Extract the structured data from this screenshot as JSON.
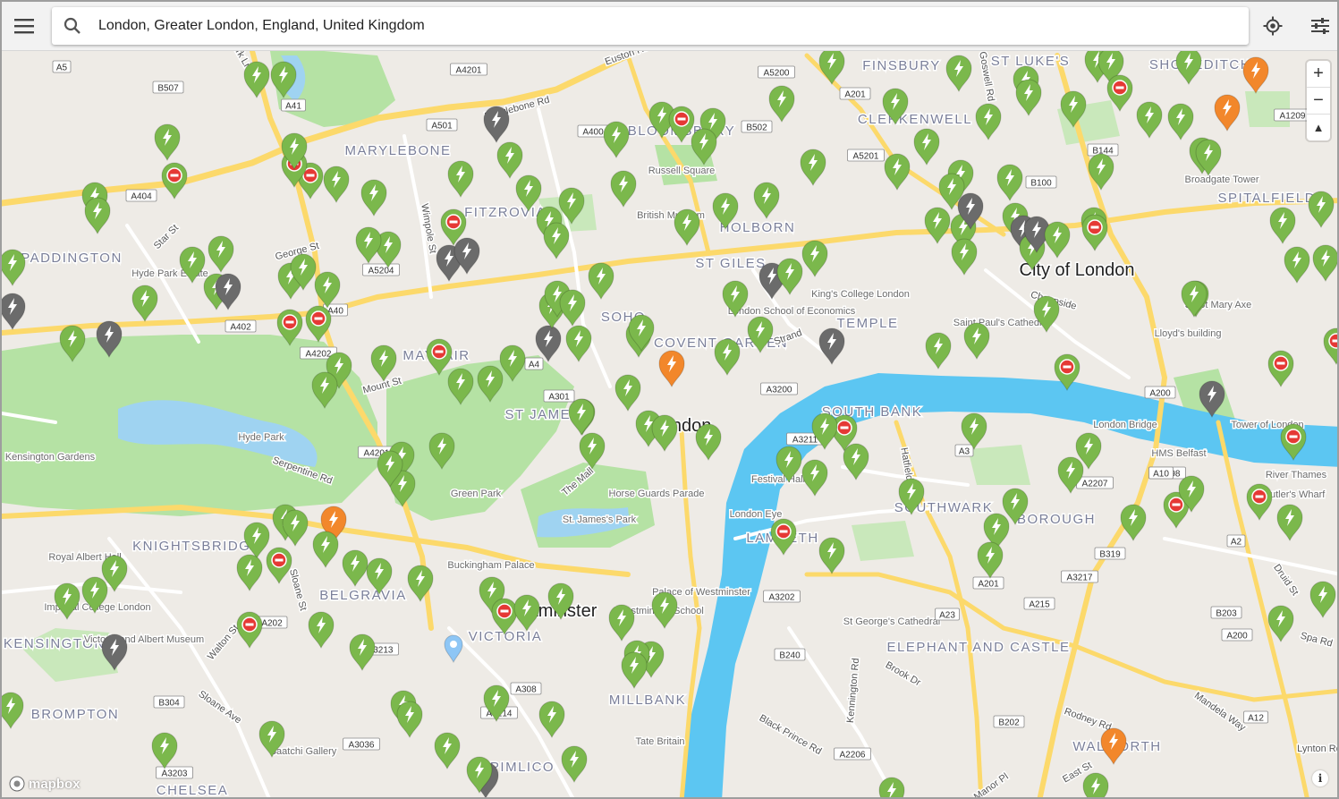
{
  "search": {
    "value": "London, Greater London, England, United Kingdom"
  },
  "icons": {
    "menu": "menu-icon",
    "search": "search-icon",
    "locate": "crosshair-icon",
    "filter": "sliders-icon",
    "zoom_in": "plus-icon",
    "zoom_out": "minus-icon",
    "compass": "compass-icon",
    "info": "info-icon"
  },
  "zoom": {
    "in_label": "+",
    "out_label": "−",
    "compass_label": "▲"
  },
  "attribution": {
    "logo_text": "mapbox",
    "info_label": "i"
  },
  "colors": {
    "water": "#9fd3f1",
    "river": "#5cc6f2",
    "park": "#b5e2a4",
    "land": "#eeebe6",
    "road": "#ffffff",
    "main_road": "#fcd96b",
    "pin_green": "#7bb84c",
    "pin_grey": "#6b6b6b",
    "pin_orange": "#f2872b",
    "pin_blue": "#8ec6f5"
  },
  "map": {
    "districts": [
      {
        "name": "MARYLEBONE"
      },
      {
        "name": "FITZROVIA"
      },
      {
        "name": "FINSBURY"
      },
      {
        "name": "ST LUKE'S"
      },
      {
        "name": "SHOREDITCH"
      },
      {
        "name": "CLERKENWELL"
      },
      {
        "name": "BLOOMSBURY"
      },
      {
        "name": "HOLBORN"
      },
      {
        "name": "ST GILES"
      },
      {
        "name": "SOHO"
      },
      {
        "name": "COVENT GARDEN"
      },
      {
        "name": "TEMPLE"
      },
      {
        "name": "MAYFAIR"
      },
      {
        "name": "ST JAMES'S"
      },
      {
        "name": "SOUTH BANK"
      },
      {
        "name": "SOUTHWARK"
      },
      {
        "name": "BOROUGH"
      },
      {
        "name": "LAMBETH"
      },
      {
        "name": "KNIGHTSBRIDGE"
      },
      {
        "name": "BELGRAVIA"
      },
      {
        "name": "VICTORIA"
      },
      {
        "name": "MILLBANK"
      },
      {
        "name": "PIMLICO"
      },
      {
        "name": "BROMPTON"
      },
      {
        "name": "PADDINGTON"
      },
      {
        "name": "SPITALFIELDS"
      },
      {
        "name": "ELEPHANT AND CASTLE"
      },
      {
        "name": "WALWORTH"
      },
      {
        "name": "CHELSEA"
      },
      {
        "name": "SOUTH KENSINGTON"
      }
    ],
    "city_labels": [
      {
        "name": "City of London"
      },
      {
        "name": "Westminster"
      },
      {
        "name": "London"
      }
    ],
    "places": [
      {
        "name": "Russell Square"
      },
      {
        "name": "British Museum"
      },
      {
        "name": "King's College London"
      },
      {
        "name": "London School of Economics"
      },
      {
        "name": "Saint Paul's Cathedral"
      },
      {
        "name": "Lloyd's building"
      },
      {
        "name": "Broadgate Tower"
      },
      {
        "name": "30 St Mary Axe"
      },
      {
        "name": "Tower of London"
      },
      {
        "name": "London Bridge"
      },
      {
        "name": "HMS Belfast"
      },
      {
        "name": "River Thames"
      },
      {
        "name": "Butler's Wharf"
      },
      {
        "name": "Hyde Park"
      },
      {
        "name": "Kensington Gardens"
      },
      {
        "name": "Green Park"
      },
      {
        "name": "St. James's Park"
      },
      {
        "name": "Horse Guards Parade"
      },
      {
        "name": "Buckingham Palace"
      },
      {
        "name": "Palace of Westminster"
      },
      {
        "name": "London Eye"
      },
      {
        "name": "Festival Hall"
      },
      {
        "name": "St George's Cathedral"
      },
      {
        "name": "Tate Britain"
      },
      {
        "name": "Royal Albert Hall"
      },
      {
        "name": "Victoria and Albert Museum"
      },
      {
        "name": "Imperial College London"
      },
      {
        "name": "Hyde Park Estate"
      },
      {
        "name": "Saatchi Gallery"
      },
      {
        "name": "Westminster School"
      }
    ],
    "streets": [
      {
        "name": "Serpentine Rd"
      },
      {
        "name": "The Mall"
      },
      {
        "name": "Strand"
      },
      {
        "name": "Mount St"
      },
      {
        "name": "George St"
      },
      {
        "name": "Star St"
      },
      {
        "name": "Wimpole St"
      },
      {
        "name": "Sloane St"
      },
      {
        "name": "Walton St"
      },
      {
        "name": "Sloane Ave"
      },
      {
        "name": "Black Prince Rd"
      },
      {
        "name": "Kennington Rd"
      },
      {
        "name": "Brook Dr"
      },
      {
        "name": "Rodney Rd"
      },
      {
        "name": "Mandela Way"
      },
      {
        "name": "Druid St"
      },
      {
        "name": "Spa Rd"
      },
      {
        "name": "Manor Pl"
      },
      {
        "name": "East St"
      },
      {
        "name": "Hatfields"
      },
      {
        "name": "Cheapside"
      },
      {
        "name": "Lynton Rd"
      },
      {
        "name": "Euston Rd"
      },
      {
        "name": "Marylebone Rd"
      },
      {
        "name": "Goswell Rd"
      },
      {
        "name": "Park Ln"
      }
    ],
    "road_shields": [
      {
        "label": "A5"
      },
      {
        "label": "B507"
      },
      {
        "label": "A41"
      },
      {
        "label": "A4201"
      },
      {
        "label": "A501"
      },
      {
        "label": "A400"
      },
      {
        "label": "B502"
      },
      {
        "label": "A5200"
      },
      {
        "label": "A201"
      },
      {
        "label": "A5201"
      },
      {
        "label": "B100"
      },
      {
        "label": "B144"
      },
      {
        "label": "A1209"
      },
      {
        "label": "A404"
      },
      {
        "label": "A40"
      },
      {
        "label": "A5204"
      },
      {
        "label": "A402"
      },
      {
        "label": "A4202"
      },
      {
        "label": "A4201"
      },
      {
        "label": "A4"
      },
      {
        "label": "A301"
      },
      {
        "label": "A3200"
      },
      {
        "label": "A3211"
      },
      {
        "label": "A3"
      },
      {
        "label": "A200"
      },
      {
        "label": "A2207"
      },
      {
        "label": "A2198"
      },
      {
        "label": "A2"
      },
      {
        "label": "B319"
      },
      {
        "label": "A3217"
      },
      {
        "label": "A202"
      },
      {
        "label": "A3213"
      },
      {
        "label": "A308"
      },
      {
        "label": "A3214"
      },
      {
        "label": "B304"
      },
      {
        "label": "A3036"
      },
      {
        "label": "A3203"
      },
      {
        "label": "A3202"
      },
      {
        "label": "B240"
      },
      {
        "label": "A201"
      },
      {
        "label": "A215"
      },
      {
        "label": "A23"
      },
      {
        "label": "B202"
      },
      {
        "label": "A2206"
      },
      {
        "label": "B203"
      },
      {
        "label": "A200"
      },
      {
        "label": "A12"
      },
      {
        "label": "A10"
      }
    ]
  }
}
